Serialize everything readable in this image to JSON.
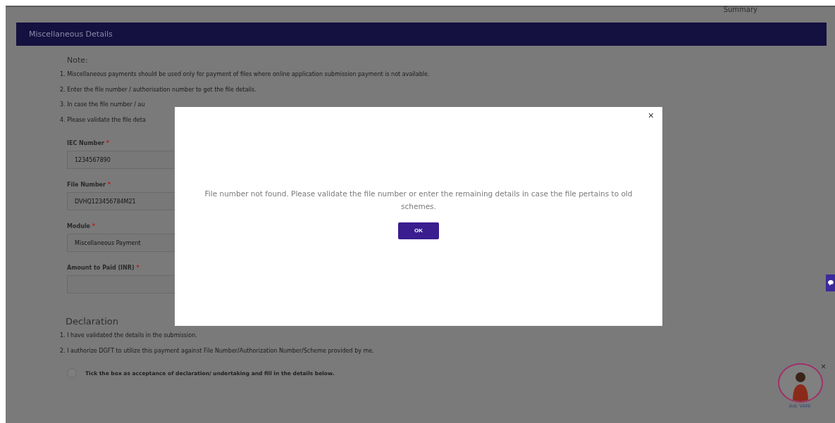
{
  "top_link": "Summary",
  "section": {
    "title": "Miscellaneous Details"
  },
  "note": {
    "heading": "Note:",
    "items": [
      "1. Miscellaneous payments should be used only for payment of files where online application submission payment is not available.",
      "2. Enter the file number / authorisation number to get the file details.",
      "3. In case the file number / au",
      "4. Please validate the file deta"
    ]
  },
  "fields": [
    {
      "label": "IEC Number",
      "required": "*",
      "value": "1234567890"
    },
    {
      "label": "File Number",
      "required": "*",
      "value": "DVHQ123456784M21"
    },
    {
      "label": "Module",
      "required": "*",
      "value": "Miscellaneous Payment"
    },
    {
      "label": "Amount to Paid (INR)",
      "required": "*"
    }
  ],
  "declaration": {
    "heading": "Declaration",
    "items": [
      "1. I have validated the details in the submission.",
      "2. I authorize DGFT to utilize this payment against File Number/Authorization Number/Scheme provided by me."
    ],
    "checkbox": {
      "label": "Tick the box as acceptance of declaration/ undertaking and fill in the details below.",
      "checked": false
    }
  },
  "modal": {
    "close": "×",
    "message": "File number not found. Please validate the file number or enter the remaining details in case the file pertains to old schemes.",
    "ok": "OK"
  },
  "assistant": {
    "label": "Ask VANI",
    "close": "×"
  }
}
